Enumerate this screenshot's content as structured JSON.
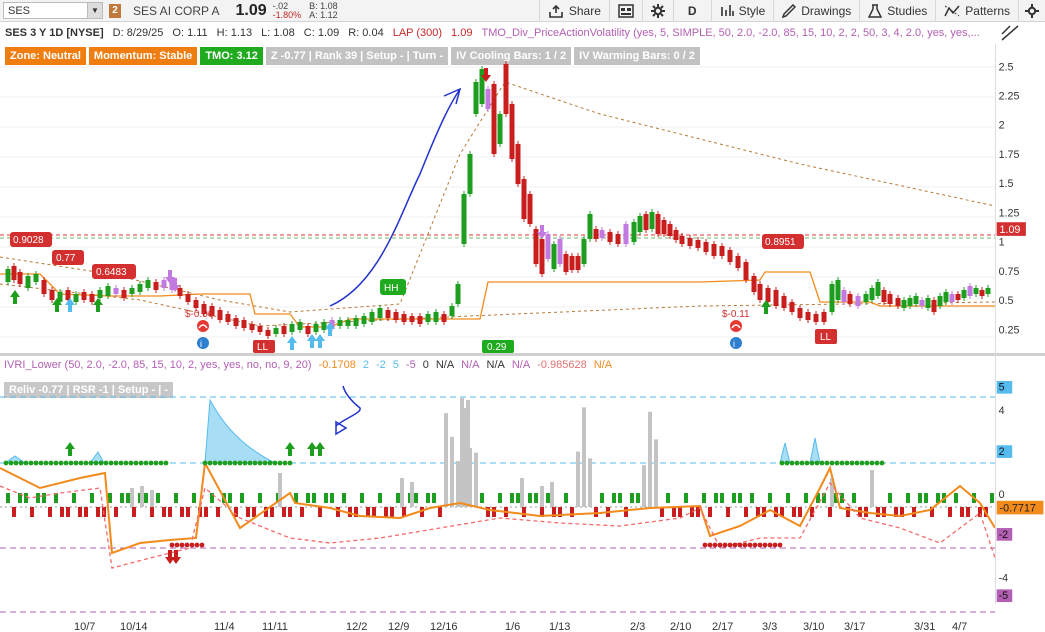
{
  "toolbar": {
    "symbol": "SES",
    "badge": "2",
    "company": "SES AI CORP A",
    "last": "1.09",
    "change": "-.02",
    "change_pct": "-1.80%",
    "bid": "B: 1.08",
    "ask": "A: 1.12",
    "share": "Share",
    "style": "Style",
    "drawings": "Drawings",
    "studies": "Studies",
    "patterns": "Patterns",
    "timeframe": "D"
  },
  "infobar": {
    "symbol": "SES 3 Y 1D [NYSE]",
    "date": "D: 8/29/25",
    "open": "O: 1.11",
    "high": "H: 1.13",
    "low": "L: 1.08",
    "close": "C: 1.09",
    "range": "R: 0.04",
    "lap": "LAP (300)",
    "lap_val": "1.09",
    "study": "TMO_Div_PriceActionVolatility (yes, 5, SIMPLE, 50, 2.0, -2.0, 85, 15, 10, 2, 2, 50, 3, 4, 2.0, yes, yes,..."
  },
  "labels": {
    "zone": "Zone: Neutral",
    "momentum": "Momentum: Stable",
    "tmo": "TMO: 3.12",
    "z": "Z -0.77 | Rank 39 | Setup - | Turn -",
    "cooling": "IV Cooling Bars: 1 / 2",
    "warming": "IV Warming Bars: 0 / 2"
  },
  "colors": {
    "zone": "#f07d10",
    "momentum": "#f07d10",
    "tmo": "#1faa1f",
    "gray": "#c2c2c2",
    "up": "#1e9e1e",
    "down": "#c81e1e",
    "orange": "#f28a1c",
    "cyan": "#55bbee"
  },
  "annotations": {
    "p1": "0.9028",
    "p2": "0.77",
    "p3": "0.6483",
    "p4": "0.8951",
    "ll1": "LL",
    "ll2": "LL",
    "hh": "HH",
    "low_bubble": "0.29",
    "cost1": "$-0.06",
    "cost2": "$-0.11",
    "price_tag": "1.09"
  },
  "lower": {
    "study": "IVRI_Lower (50, 2.0, -2.0, 85, 15, 10, 2, yes, yes, no, no, 9, 20)",
    "v1": "-0.1708",
    "v2": "2",
    "v3": "-2",
    "v4": "5",
    "v5": "-5",
    "v6": "0",
    "na1": "N/A",
    "na2": "N/A",
    "na3": "N/A",
    "na4": "N/A",
    "v7": "-0.985628",
    "na5": "N/A",
    "reliv": "Reliv -0.77 | RSR -1 | Setup - | -",
    "tag": "-0.7717"
  },
  "axis_upper": [
    "2.5",
    "2.25",
    "2",
    "1.75",
    "1.5",
    "1.25",
    "1",
    "0.75",
    "0.5",
    "0.25"
  ],
  "axis_lower": [
    "5",
    "4",
    "2",
    "0",
    "-2",
    "-4",
    "-5"
  ],
  "xaxis": [
    "10/7",
    "10/14",
    "11/4",
    "11/11",
    "12/2",
    "12/9",
    "12/16",
    "1/6",
    "1/13",
    "2/3",
    "2/10",
    "2/17",
    "3/3",
    "3/10",
    "3/17",
    "3/31",
    "4/7"
  ]
}
